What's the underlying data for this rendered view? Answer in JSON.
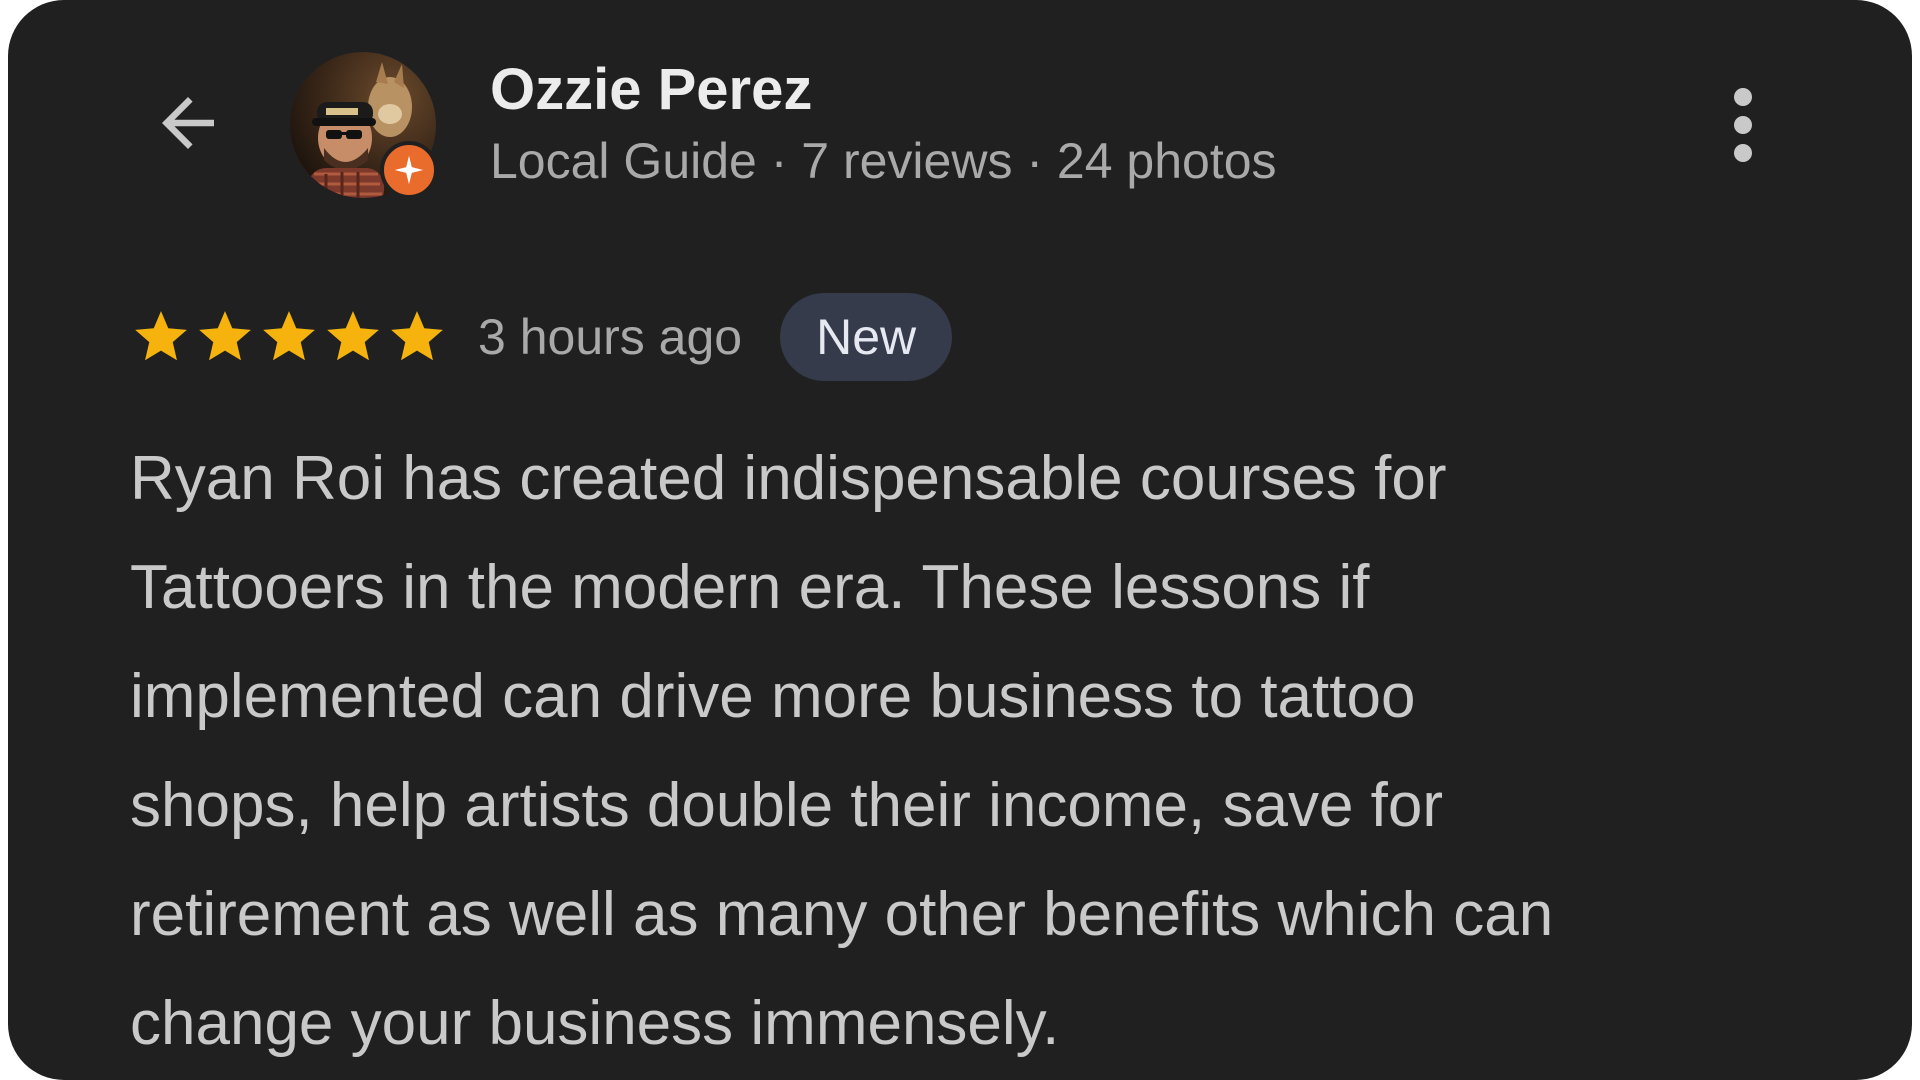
{
  "header": {
    "back_icon": "arrow-left-icon",
    "more_icon": "more-vert-icon",
    "avatar": {
      "icon": "user-avatar",
      "badge_icon": "local-guide-badge-icon",
      "badge_color": "#ea6c2d"
    },
    "reviewer_name": "Ozzie Perez",
    "reviewer_meta": "Local Guide · 7 reviews · 24 photos"
  },
  "review": {
    "rating": 5,
    "rating_max": 5,
    "star_color": "#f6b30e",
    "time_ago": "3 hours ago",
    "badge_label": "New",
    "text": "Ryan Roi has created indispensable courses for\nTattooers in the modern era. These lessons if\nimplemented can drive more business to tattoo\nshops, help artists double their income, save for\nretirement as well as many other benefits which can\nchange your business immensely."
  },
  "colors": {
    "background": "#202020",
    "badge_background": "#353b4b"
  }
}
